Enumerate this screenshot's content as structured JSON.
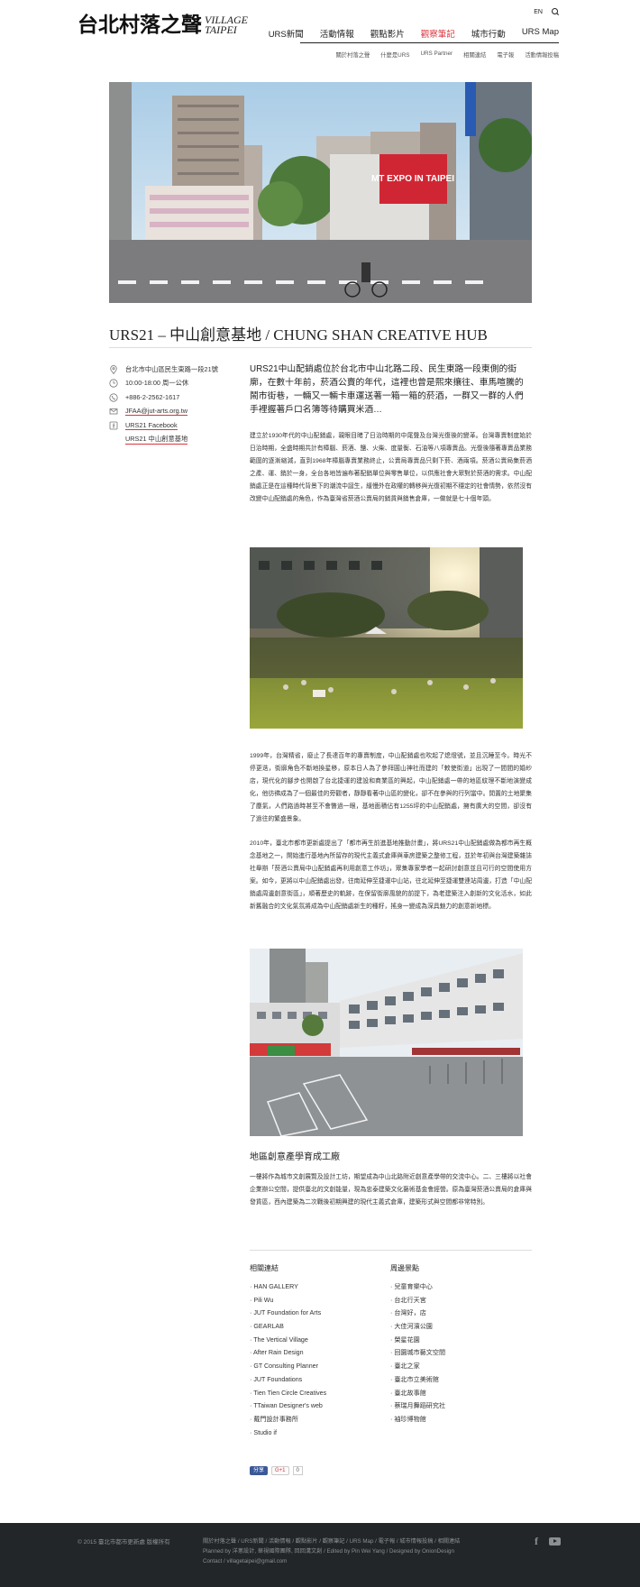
{
  "header": {
    "logo_zh": "台北村落之聲",
    "logo_en_1": "VILLAGE",
    "logo_en_2": "TAIPEI",
    "lang": "EN",
    "nav": [
      "URS新聞",
      "活動情報",
      "觀點影片",
      "觀察筆記",
      "城市行動",
      "URS Map"
    ],
    "nav_active": 3,
    "subnav": [
      "關於村落之聲",
      "什麼是URS",
      "URS Partner",
      "相關連結",
      "電子報",
      "活動情報投稿"
    ]
  },
  "title": "URS21 – 中山創意基地 / CHUNG SHAN CREATIVE HUB",
  "hero_sign": "MT EXPO IN TAIPEI",
  "info": [
    {
      "icon": "location-pin-icon",
      "text": "台北市中山區民生東路一段21號"
    },
    {
      "icon": "clock-icon",
      "text": "10:00-18:00 周一公休"
    },
    {
      "icon": "phone-icon",
      "text": "+886-2-2562-1617"
    },
    {
      "icon": "mail-icon",
      "text": "JFAA@jut-arts.org.tw"
    },
    {
      "icon": "facebook-icon",
      "text": "URS21 Facebook"
    },
    {
      "icon": "",
      "text": "URS21 中山創意基地"
    }
  ],
  "lead": "URS21中山配銷處位於台北市中山北路二段、民生東路一段東側的街廓，在數十年前，菸酒公賣的年代，這裡也曾是熙來攘往、車馬喧騰的鬧市街巷，一輛又一輛卡車運送著一箱一箱的菸酒，一群又一群的人們手裡握著戶口名簿等待購買米酒…",
  "para1": "建立於1930年代的中山配銷處，親眼目睹了日治時期的中尾聲及台灣光復後的變革。台灣專賣制度始於日治時期，全盛時期共計有樟腦、菸酒、鹽、火柴、度量衡、石油等八項專賣品。光復後隨著專賣品業務範圍的逐漸縮減，直到1968年樟腦專賣業務終止，公賣局專賣品只剩下菸、酒兩項。菸酒公賣局集菸酒之產、運、銷於一身，全台各地皆遍布著配銷單位與零售單位，以供應社會大眾對於菸酒的需求。中山配銷處正是在這種時代背景下的潮流中誕生，緩慢外在政權的轉移與光復初期不穩定的社會情勢，依然沒有改變中山配銷處的角色，作為臺灣省菸酒公賣局的銷貨與銷售倉庫，一做就是七十個年頭。",
  "para2": "1999年，台灣精省，廢止了長達百年的專賣制度，中山配銷處也吹起了熄燈號，並且沉睡至今。時光不停更迭，街廓角色不斷地換星移，原本日人為了參拜圓山神社而建的「敕使街道」出現了一間間的婚紗店，現代化的腳步也開啟了台北捷運的建設和商業區的興起，中山配銷處一帶的地區紋理不斷地演變成化，他彷彿成為了一個最佳的旁觀者，靜靜看著中山區的變化，卻不在參與的行列當中。閒置的土地聚集了塵氣，人們路過時甚至不會瞥過一眼，基地面積佔有1255坪的中山配銷處，擁有廣大的空間，卻沒有了過往的繁盛景象。",
  "para3": "2010年，臺北市都市更新處提出了「都市再生前進基地推動計畫」，將URS21中山配銷處做為都市再生概念基地之一，開始進行基地內所留存的現代主義式倉庫與車房建築之整修工程，並於年初與台灣建築雜誌社舉辦「菸酒公賣局中山配銷處再利用創意工作坊」，眾集專家學者一起研討創意並且可行的空間使用方案。如今，更將以中山配銷處出發，往南延伸至捷運中山站，往北延伸至捷運雙連站周邊，打造「中山配銷處周邊創意街區」，順著歷史的軌跡，在保留街廓風貌的前提下，為老建築注入創新的文化活水，如此新舊融合的文化氣氛將成為中山配銷處新生的種籽，搖身一變成為深具魅力的創意新地標。",
  "subhead": "地區創意產學育成工廠",
  "para4": "一樓將作為城市文創展覽及設計工坊，期望成為中山北路附近創意產學帶的交流中心。二、三樓將以社會企業辦公空間，提供臺北的文創能量，現為忠泰建築文化藝術基金會經營。原為臺灣菸酒公賣局的倉庫與發貨區，西內建築為二次戰後初期興建的現代主義式倉庫，建築形式與空間都非常特別。",
  "related_links": {
    "heading": "相關連結",
    "items": [
      "HAN GALLERY",
      "Pili Wu",
      "JUT Foundation for Arts",
      "GEARLAB",
      "The Vertical Village",
      "After Rain Design",
      "GT Consulting Planner",
      "JUT Foundations",
      "Tien Tien Circle Creatives",
      "TTaiwan Designer's web",
      "戴門設計事務所",
      "Studio if"
    ]
  },
  "nearby": {
    "heading": "周邊景點",
    "items": [
      "兒童育樂中心",
      "台北行天宮",
      "台灣好，店",
      "大佳河濱公園",
      "榮星花園",
      "回園城市藝文空間",
      "臺北之家",
      "臺北市立美術館",
      "臺北故事館",
      "蔡瑞月舞蹈研究社",
      "袖珍博物館"
    ]
  },
  "share": {
    "fb": "分享",
    "gplus": "G+1",
    "count": "0"
  },
  "footer": {
    "copyright": "© 2015 臺北市都市更新處 版權所有",
    "line1": "關於村落之聲 / URS新聞 / 活動情報 / 觀點影片 / 觀察筆記 / URS Map / 電子報 / 城市情報投稿 / 相關連結",
    "line2": "Planned by 洋蔥設計, 華視國際團隊, 回回溝文創 / Edited by Pin Wei Yang / Designed by OnionDesign",
    "line3": "Contact / villagetaipei@gmail.com"
  },
  "colors": {
    "accent": "#d9363e",
    "footer_bg": "#222628"
  }
}
